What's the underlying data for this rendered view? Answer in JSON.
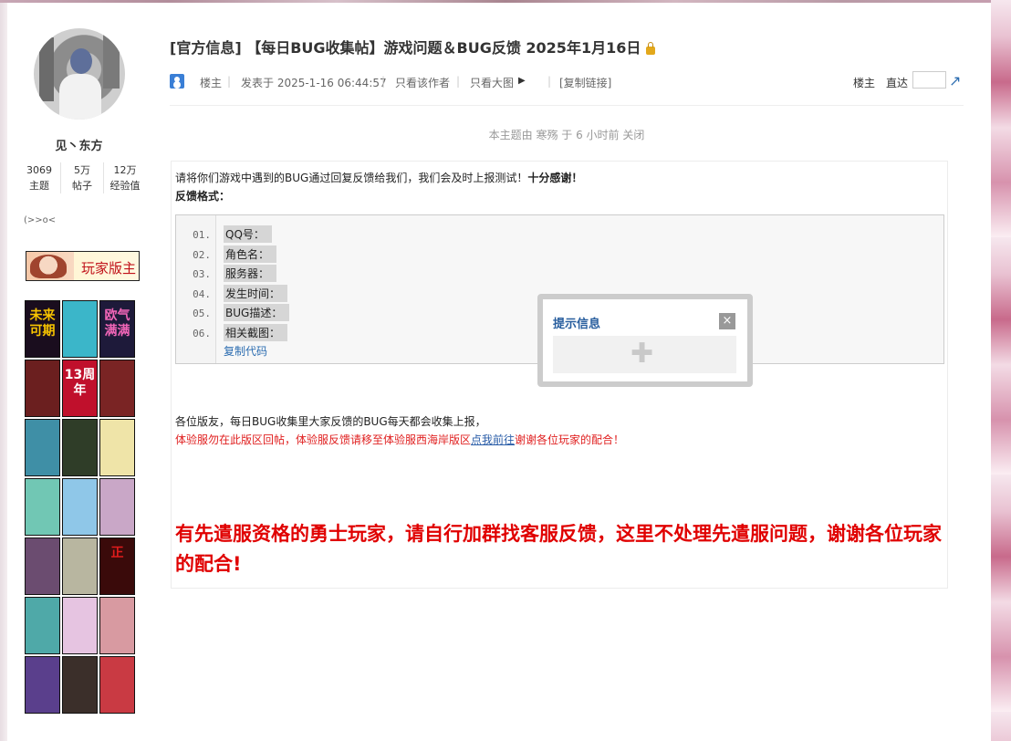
{
  "author": {
    "name": "见丶东方",
    "stats": [
      {
        "value": "3069",
        "label": "主题"
      },
      {
        "value": "5万",
        "label": "帖子"
      },
      {
        "value": "12万",
        "label": "经验值"
      }
    ],
    "signature": "(>>o<",
    "medal_label": "玩家版主",
    "badge_tiles": [
      {
        "text": "未来可期",
        "bg": "#1a0d1e",
        "fg": "#f8c400"
      },
      {
        "text": "",
        "bg": "#3bb6c9",
        "fg": "#ffffff"
      },
      {
        "text": "欧气满满",
        "bg": "#1e1a3a",
        "fg": "#f266b8"
      },
      {
        "text": "",
        "bg": "#6b1f1f",
        "fg": "#ffffff"
      },
      {
        "text": "13周年",
        "bg": "#c0102c",
        "fg": "#ffffff"
      },
      {
        "text": "",
        "bg": "#7a2424",
        "fg": "#ffffff"
      },
      {
        "text": "",
        "bg": "#3f8fa6",
        "fg": "#ffffff"
      },
      {
        "text": "",
        "bg": "#2f3d28",
        "fg": "#ffffff"
      },
      {
        "text": "",
        "bg": "#efe4a8",
        "fg": "#ffffff"
      },
      {
        "text": "",
        "bg": "#71c7b4",
        "fg": "#ffffff"
      },
      {
        "text": "",
        "bg": "#8fc7e8",
        "fg": "#ffffff"
      },
      {
        "text": "",
        "bg": "#c9a7c7",
        "fg": "#ffffff"
      },
      {
        "text": "",
        "bg": "#6b4c70",
        "fg": "#ffffff"
      },
      {
        "text": "",
        "bg": "#b8b6a0",
        "fg": "#ffffff"
      },
      {
        "text": "正",
        "bg": "#3a0a0a",
        "fg": "#e01c1c"
      },
      {
        "text": "",
        "bg": "#4fa9a8",
        "fg": "#ffffff"
      },
      {
        "text": "",
        "bg": "#e6c4e1",
        "fg": "#ffffff"
      },
      {
        "text": "",
        "bg": "#d89aa1",
        "fg": "#ffffff"
      },
      {
        "text": "",
        "bg": "#5a3f8c",
        "fg": "#ffffff"
      },
      {
        "text": "",
        "bg": "#3b2f2a",
        "fg": "#ffffff"
      },
      {
        "text": "",
        "bg": "#c93a43",
        "fg": "#ffffff"
      }
    ]
  },
  "thread": {
    "title": "[官方信息] 【每日BUG收集帖】游戏问题＆BUG反馈 2025年1月16日"
  },
  "meta": {
    "floor_label": "楼主",
    "posted_at": "发表于 2025-1-16 06:44:57",
    "only_author": "只看该作者",
    "only_big_image": "只看大图",
    "copy_link": "[复制链接]",
    "floor_right": "楼主",
    "jump_label": "直达",
    "jump_value": "",
    "separator": "|"
  },
  "closed_notice": "本主题由 寒殇 于 6 小时前 关闭",
  "post": {
    "intro": "请将你们游戏中遇到的BUG通过回复反馈给我们，我们会及时上报测试！",
    "intro_bold": "十分感谢！",
    "format_label": "反馈格式：",
    "code_lines": [
      {
        "num": "01.",
        "text": "QQ号："
      },
      {
        "num": "02.",
        "text": "角色名："
      },
      {
        "num": "03.",
        "text": "服务器："
      },
      {
        "num": "04.",
        "text": "发生时间："
      },
      {
        "num": "05.",
        "text": "BUG描述："
      },
      {
        "num": "06.",
        "text": "相关截图："
      }
    ],
    "copy_code": "复制代码",
    "para1": "各位版友，每日BUG收集里大家反馈的BUG每天都会收集上报，",
    "para2_before": "体验服勿在此版区回帖，体验服反馈请移至体验服西海岸版区",
    "para2_link": "点我前往",
    "para2_after": "谢谢各位玩家的配合！",
    "big_notice": "有先遣服资格的勇士玩家，请自行加群找客服反馈，这里不处理先遣服问题，谢谢各位玩家的配合!"
  },
  "popup": {
    "title": "提示信息",
    "close_glyph": "×",
    "loading_glyph": "✚"
  }
}
